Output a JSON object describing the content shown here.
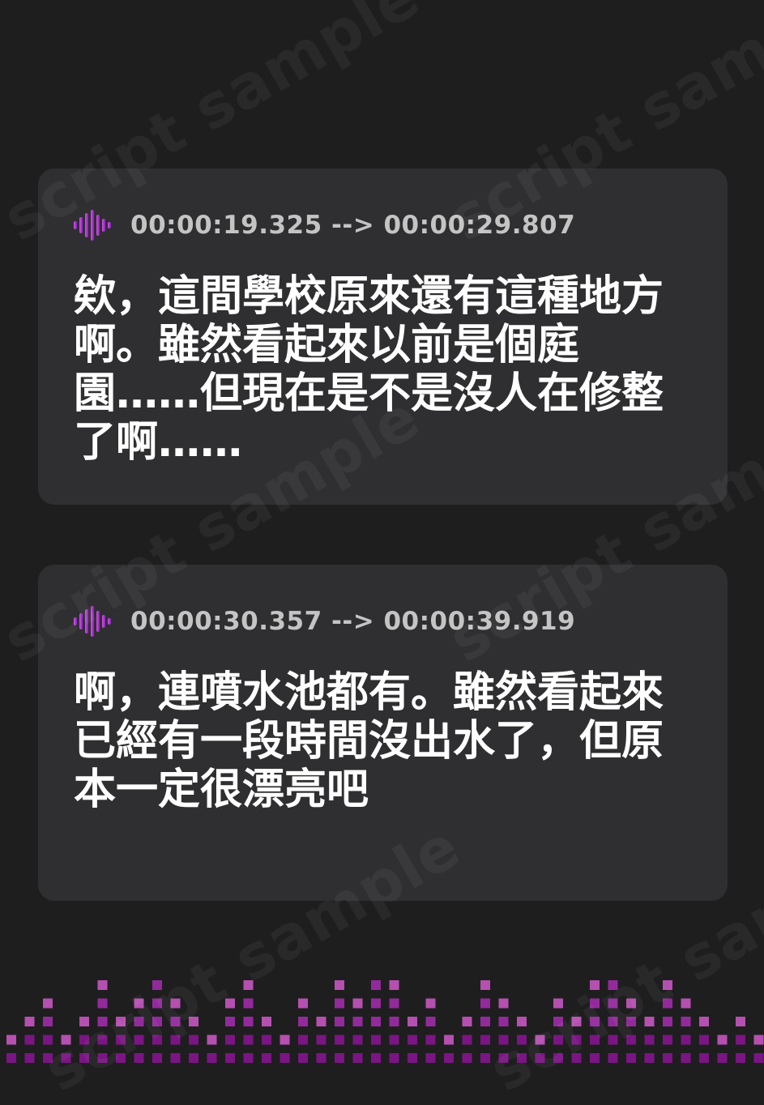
{
  "watermark": {
    "text": "script sample"
  },
  "cards": [
    {
      "timestamp": "00:00:19.325 --> 00:00:29.807",
      "text": "欸，這間學校原來還有這種地方啊。雖然看起來以前是個庭園……但現在是不是沒人在修整了啊……"
    },
    {
      "timestamp": "00:00:30.357 --> 00:00:39.919",
      "text": "啊，連噴水池都有。雖然看起來已經有一段時間沒出水了，但原本一定很漂亮吧"
    }
  ],
  "icons": {
    "card_icon": "audio-waveform-icon"
  },
  "colors": {
    "background": "#1e1e1f",
    "card": "#2f2f31",
    "timestamp_text": "#c4c4c4",
    "body_text": "#ffffff",
    "wave_gradient": [
      "#e04fd6",
      "#7a22c8"
    ],
    "equalizer_dark": "#7a1583",
    "equalizer_mid": "#932a9c",
    "equalizer_light": "#b550b0"
  }
}
